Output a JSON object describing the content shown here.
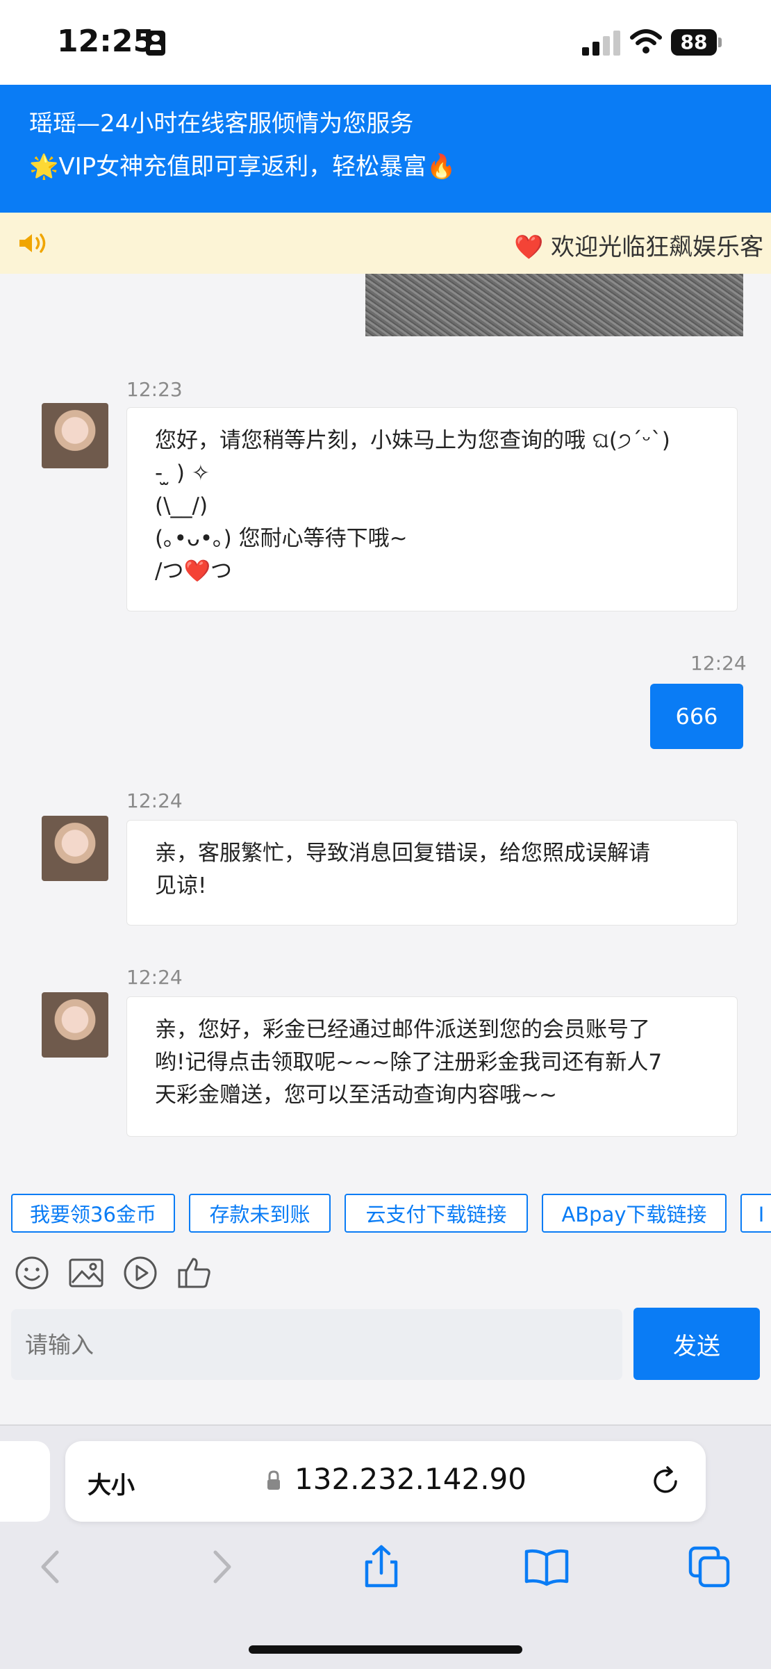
{
  "status_bar": {
    "time": "12:25",
    "battery": "88"
  },
  "header": {
    "line1": "瑶瑶—24小时在线客服倾情为您服务",
    "line2": "🌟VIP女神充值即可享返利，轻松暴富🔥"
  },
  "notice": {
    "text": "❤️ 欢迎光临狂飙娱乐客"
  },
  "messages": [
    {
      "time": "12:23",
      "lines": [
        "您好，请您稍等片刻，小妹马上为您查询的哦 ଘ(੭ˊᵕˋ)",
        "- ̫ ) ✧",
        "(\\__/)",
        "(｡•ᴗ•｡) 您耐心等待下哦~",
        "/つ❤️つ"
      ]
    },
    {
      "time": "12:24",
      "text": "666"
    },
    {
      "time": "12:24",
      "lines": [
        "亲，客服繁忙，导致消息回复错误，给您照成误解请",
        "见谅!"
      ]
    },
    {
      "time": "12:24",
      "lines": [
        "亲，您好，彩金已经通过邮件派送到您的会员账号了",
        "哟!记得点击领取呢~~~除了注册彩金我司还有新人7",
        "天彩金赠送，您可以至活动查询内容哦~~"
      ]
    }
  ],
  "quick_replies": [
    "我要领36金币",
    "存款未到账",
    "云支付下载链接",
    "ABpay下载链接",
    "I"
  ],
  "tools": [
    "emoji-icon",
    "image-icon",
    "video-icon",
    "thumbs-up-icon"
  ],
  "input": {
    "placeholder": "请输入",
    "send_label": "发送"
  },
  "browser": {
    "text_size_label": "大小",
    "url": "132.232.142.90"
  },
  "colors": {
    "accent": "#0a7cf5",
    "notice_bg": "#fcf4d6",
    "chat_bg": "#f4f4f6"
  }
}
